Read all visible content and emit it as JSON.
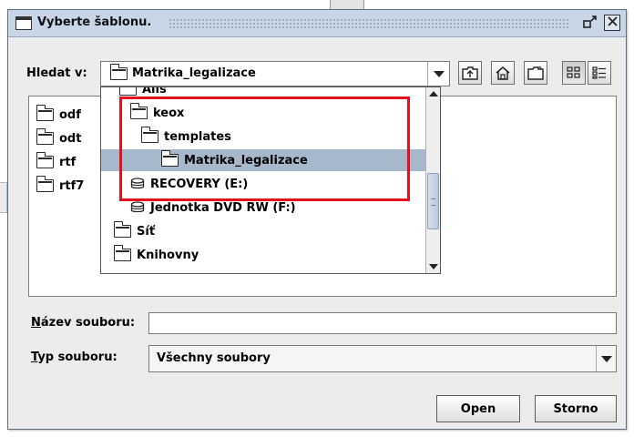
{
  "dialog": {
    "title": "Vyberte šablonu."
  },
  "look_in": {
    "label": "Hledat v:",
    "value": "Matrika_legalizace"
  },
  "toolbar": {
    "buttons": [
      "up-one-level-icon",
      "home-icon",
      "new-folder-icon",
      "list-view-icon",
      "details-view-icon"
    ]
  },
  "files": [
    {
      "name": "odf"
    },
    {
      "name": "odt"
    },
    {
      "name": "rtf"
    },
    {
      "name": "rtf7"
    }
  ],
  "dropdown": {
    "items": [
      {
        "label": "Alis",
        "icon": "folder"
      },
      {
        "label": "keox",
        "icon": "folder"
      },
      {
        "label": "templates",
        "icon": "folder"
      },
      {
        "label": "Matrika_legalizace",
        "icon": "folder",
        "selected": true
      },
      {
        "label": "RECOVERY (E:)",
        "icon": "drive"
      },
      {
        "label": "Jednotka DVD RW (F:)",
        "icon": "drive"
      },
      {
        "label": "Síť",
        "icon": "folder"
      },
      {
        "label": "Knihovny",
        "icon": "folder"
      }
    ],
    "highlight_color": "#e5101d",
    "selection_color": "#a7b8cc"
  },
  "file_name": {
    "label_prefix": "N",
    "label_rest": "ázev souboru:",
    "value": ""
  },
  "file_type": {
    "label_prefix": "T",
    "label_rest": "yp souboru:",
    "value": "Všechny soubory"
  },
  "buttons": {
    "open": "Open",
    "cancel": "Storno"
  },
  "colors": {
    "titlebar": "#c8d6e8",
    "dialog_bg": "#ececec"
  }
}
